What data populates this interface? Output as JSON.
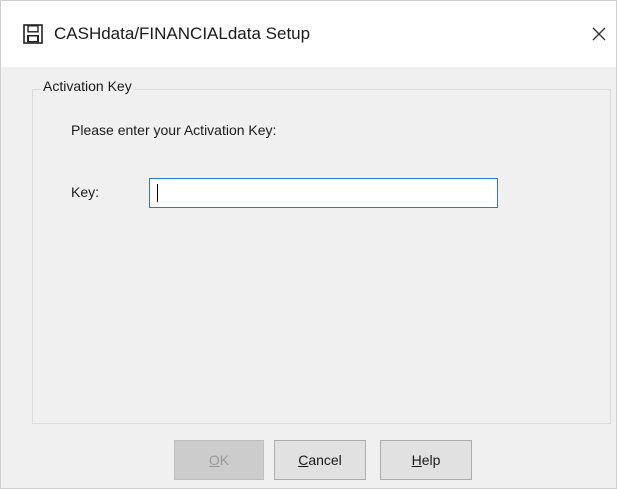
{
  "window": {
    "title": "CASHdata/FINANCIALdata Setup",
    "close_glyph": "✕",
    "icon": "floppy-disk-icon"
  },
  "group": {
    "legend": "Activation Key",
    "prompt": "Please enter your Activation Key:",
    "key_label": "Key:",
    "key_value": "",
    "key_placeholder": ""
  },
  "buttons": {
    "ok": {
      "mnemonic": "O",
      "rest": "K",
      "enabled": false
    },
    "cancel": {
      "mnemonic": "C",
      "rest": "ancel",
      "enabled": true
    },
    "help": {
      "mnemonic": "H",
      "rest": "elp",
      "enabled": true
    }
  },
  "colors": {
    "input_focus_border": "#2a78c8",
    "dialog_bg": "#f0f0f0",
    "titlebar_bg": "#ffffff"
  }
}
